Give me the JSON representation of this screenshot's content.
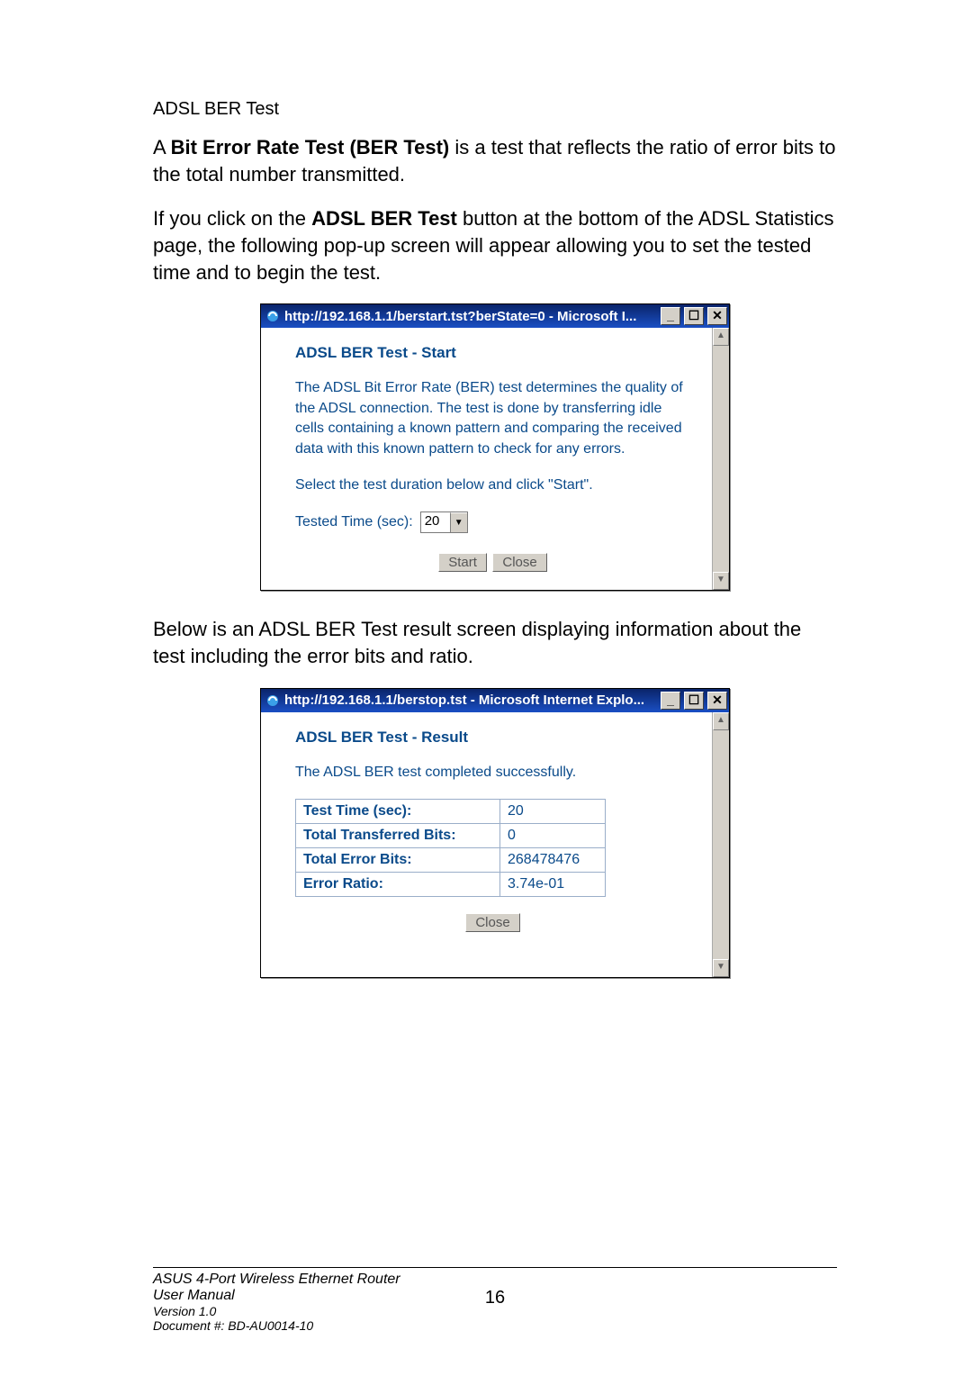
{
  "section_title": "ADSL BER Test",
  "para1_pre": "A ",
  "para1_bold": "Bit Error Rate Test (BER Test)",
  "para1_post": " is a test that reflects the ratio of error bits to the total number transmitted.",
  "para2_pre": "If you click on the ",
  "para2_bold": "ADSL BER Test",
  "para2_post": " button at the bottom of the ADSL Statistics page, the following pop-up screen will appear allowing you to set the tested time and to begin the test.",
  "popup1": {
    "title": "http://192.168.1.1/berstart.tst?berState=0 - Microsoft I...",
    "heading": "ADSL BER Test - Start",
    "desc": "The ADSL Bit Error Rate (BER) test determines the quality of the ADSL connection. The test is done by transferring idle cells containing a known pattern and comparing the received data with this known pattern to check for any errors.",
    "instr": "Select the test duration below and click \"Start\".",
    "field_label": "Tested Time (sec):",
    "field_value": "20",
    "btn_start": "Start",
    "btn_close": "Close"
  },
  "para3": "Below is an ADSL BER Test result screen displaying information about the test including the error bits and ratio.",
  "popup2": {
    "title": "http://192.168.1.1/berstop.tst - Microsoft Internet Explo...",
    "heading": "ADSL BER Test - Result",
    "msg": "The ADSL BER test completed successfully.",
    "rows": [
      {
        "label": "Test Time (sec):",
        "value": "20"
      },
      {
        "label": "Total Transferred Bits:",
        "value": "0"
      },
      {
        "label": "Total Error Bits:",
        "value": "268478476"
      },
      {
        "label": "Error Ratio:",
        "value": "3.74e-01"
      }
    ],
    "btn_close": "Close"
  },
  "win": {
    "minimize": "_",
    "maximize": "☐",
    "close": "✕",
    "up": "▲",
    "down": "▼"
  },
  "footer": {
    "line1": "ASUS 4-Port Wireless Ethernet Router",
    "line2": "User Manual",
    "line3": "Version 1.0",
    "line4": "Document #:  BD-AU0014-10",
    "page": "16"
  }
}
